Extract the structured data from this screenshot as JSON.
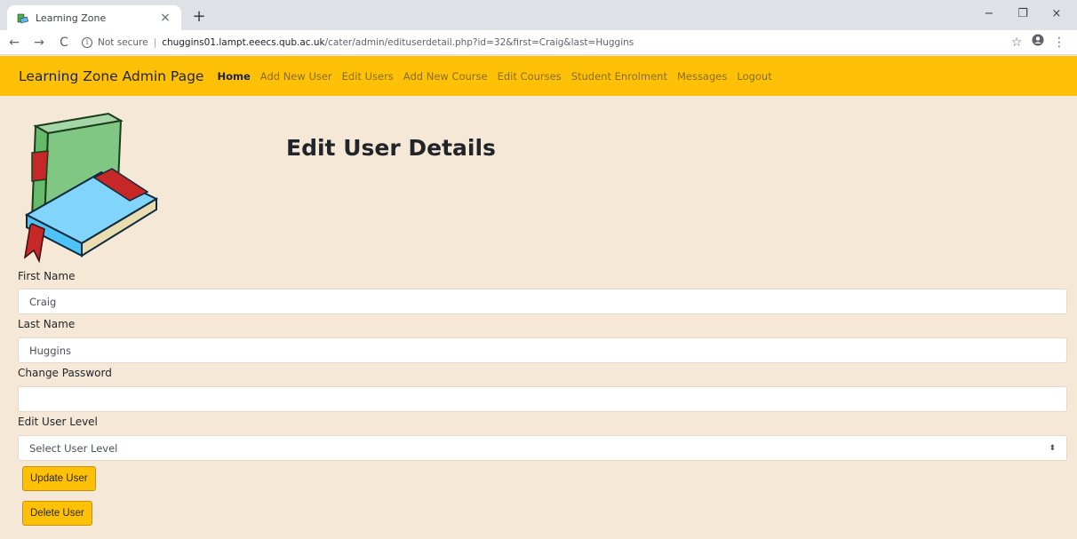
{
  "browser": {
    "tab_title": "Learning Zone",
    "tab_close": "×",
    "new_tab": "+",
    "not_secure": "Not secure",
    "separator": "|",
    "url_host": "chuggins01.lampt.eeecs.qub.ac.uk",
    "url_path": "/cater/admin/edituserdetail.php?id=32&first=Craig&last=Huggins",
    "window_minimize": "−",
    "window_maximize": "❐",
    "window_close": "×",
    "back": "←",
    "forward": "→",
    "reload": "C",
    "star": "☆",
    "menu": "⋮"
  },
  "navbar": {
    "brand": "Learning Zone Admin Page",
    "items": [
      {
        "label": "Home",
        "active": true
      },
      {
        "label": "Add New User"
      },
      {
        "label": "Edit Users"
      },
      {
        "label": "Add New Course"
      },
      {
        "label": "Edit Courses"
      },
      {
        "label": "Student Enrolment"
      },
      {
        "label": "Messages"
      },
      {
        "label": "Logout"
      }
    ]
  },
  "page": {
    "title": "Edit User Details"
  },
  "form": {
    "first_name_label": "First Name",
    "first_name_value": "Craig",
    "last_name_label": "Last Name",
    "last_name_value": "Huggins",
    "password_label": "Change Password",
    "password_value": "",
    "user_level_label": "Edit User Level",
    "user_level_selected": "Select User Level",
    "update_button": "Update User",
    "delete_button": "Delete User"
  },
  "colors": {
    "navbar": "#ffc107",
    "page_background": "#f6e8d7",
    "button": "#ffc107"
  }
}
